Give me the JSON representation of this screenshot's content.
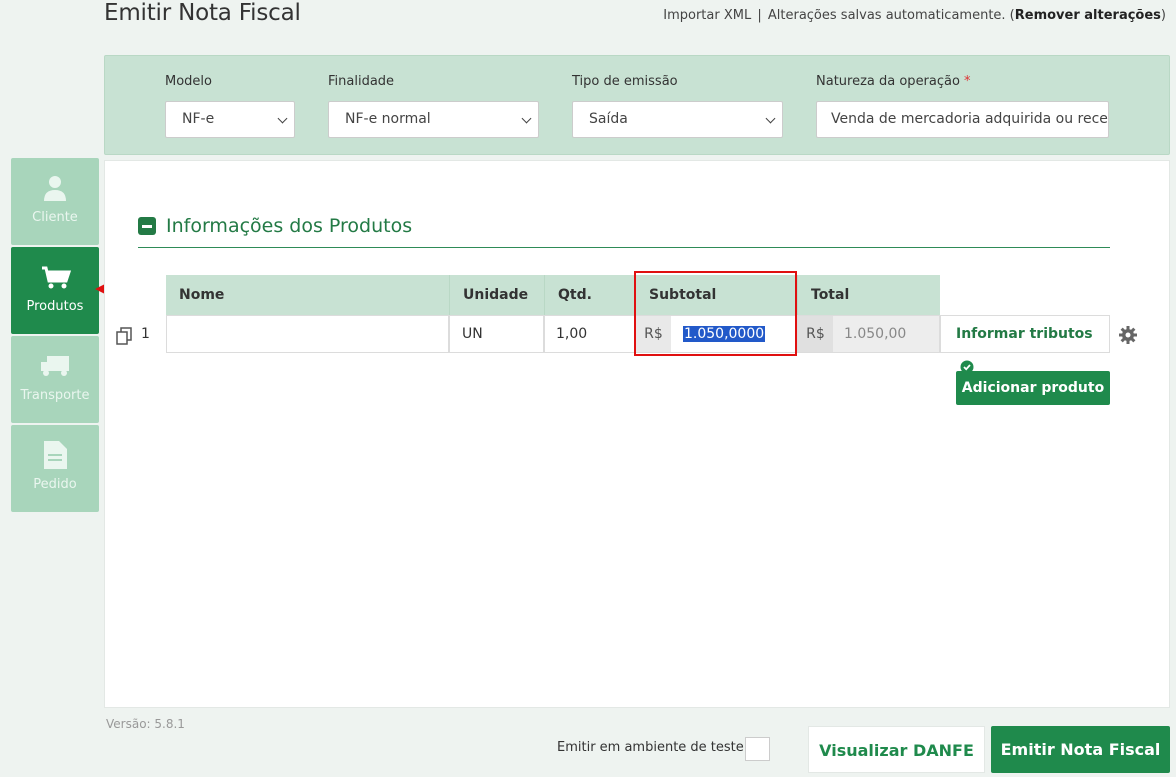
{
  "header": {
    "title": "Emitir Nota Fiscal",
    "import_xml": "Importar XML",
    "separator": "|",
    "autosave_text": "Alterações salvas automaticamente. (",
    "remove_changes": "Remover alterações",
    "close_paren": ")"
  },
  "config": {
    "modelo": {
      "label": "Modelo",
      "value": "NF-e"
    },
    "finalidade": {
      "label": "Finalidade",
      "value": "NF-e normal"
    },
    "tipo_emissao": {
      "label": "Tipo de emissão",
      "value": "Saída"
    },
    "natureza": {
      "label": "Natureza da operação",
      "required_mark": "*",
      "value": "Venda de mercadoria adquirida ou rece"
    }
  },
  "sidenav": {
    "items": [
      {
        "label": "Cliente",
        "icon": "user-icon"
      },
      {
        "label": "Produtos",
        "icon": "cart-icon"
      },
      {
        "label": "Transporte",
        "icon": "truck-icon"
      },
      {
        "label": "Pedido",
        "icon": "document-icon"
      }
    ],
    "active": "Produtos"
  },
  "products": {
    "section_title": "Informações dos Produtos",
    "columns": {
      "nome": "Nome",
      "unidade": "Unidade",
      "qtd": "Qtd.",
      "subtotal": "Subtotal",
      "total": "Total"
    },
    "rows": [
      {
        "index": "1",
        "nome": "",
        "unidade": "UN",
        "qtd": "1,00",
        "currency": "R$",
        "subtotal": "1.050,0000",
        "total": "1.050,00"
      }
    ],
    "informar_tributos": "Informar tributos",
    "add_product": "Adicionar produto"
  },
  "footer": {
    "version": "Versão: 5.8.1",
    "test_env_label": "Emitir em ambiente de teste",
    "visualizar": "Visualizar DANFE",
    "emitir": "Emitir Nota Fiscal"
  },
  "colors": {
    "brand_green": "#1f8a4c",
    "panel_green": "#c8e2d3",
    "highlight_red": "#e01010"
  }
}
